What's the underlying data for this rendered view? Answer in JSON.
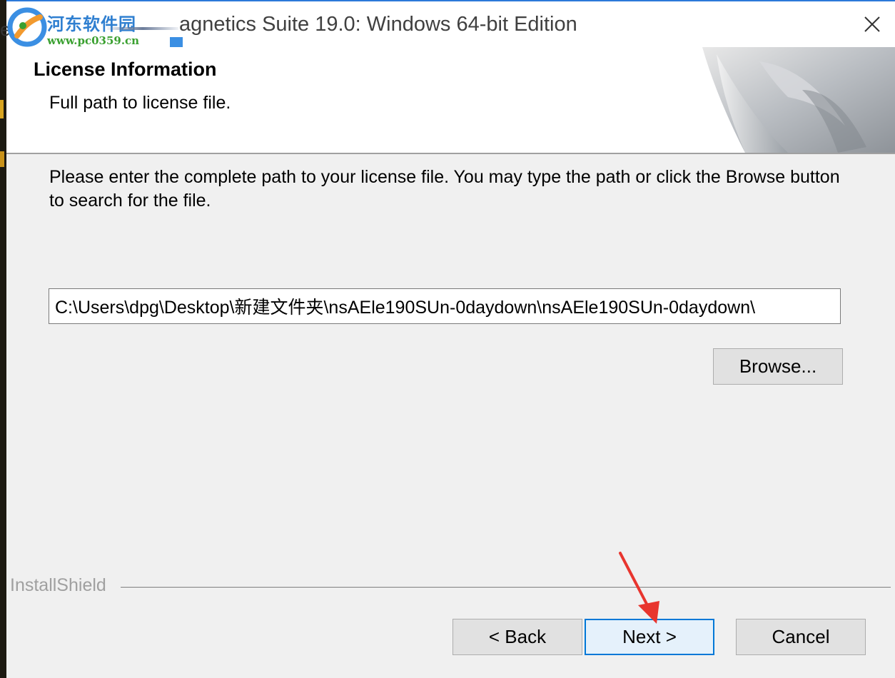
{
  "window": {
    "title": "agnetics Suite 19.0: Windows 64-bit Edition",
    "close_icon": "close-icon"
  },
  "watermark": {
    "partial_char": "e",
    "name": "河东软件园",
    "url": "www.pc0359.cn"
  },
  "header": {
    "title": "License Information",
    "subtitle": "Full path to license file."
  },
  "body": {
    "instructions": "Please enter the complete path to your license file. You may type the path or click the Browse button to search for the file."
  },
  "license_path": {
    "value": "C:\\Users\\dpg\\Desktop\\新建文件夹\\nsAEle190SUn-0daydown\\nsAEle190SUn-0daydown\\"
  },
  "buttons": {
    "browse": "Browse...",
    "back": "< Back",
    "next": "Next >",
    "cancel": "Cancel"
  },
  "branding": {
    "installshield": "InstallShield"
  },
  "colors": {
    "accent": "#0078d7",
    "annotation_arrow": "#e8352e",
    "watermark_blue": "#2f7fd0",
    "watermark_green": "#3aa030"
  }
}
